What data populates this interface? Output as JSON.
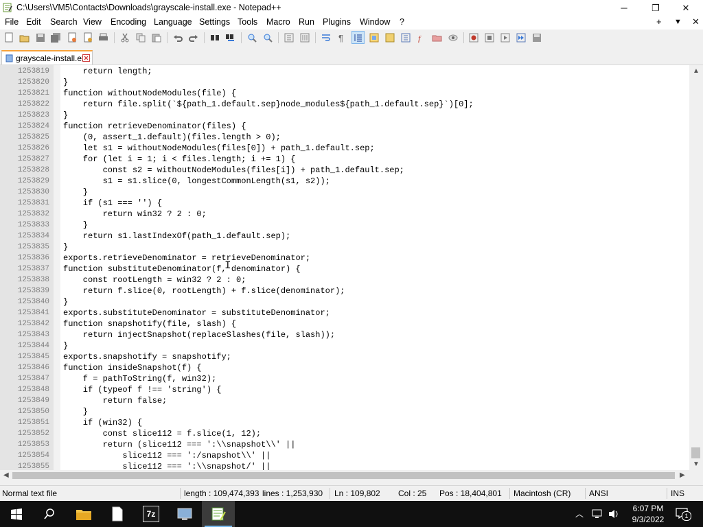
{
  "window": {
    "title": "C:\\Users\\VM5\\Contacts\\Downloads\\grayscale-install.exe - Notepad++",
    "minimize_glyph": "─",
    "maximize_glyph": "❐",
    "close_glyph": "✕"
  },
  "menu": {
    "items": [
      "File",
      "Edit",
      "Search",
      "View",
      "Encoding",
      "Language",
      "Settings",
      "Tools",
      "Macro",
      "Run",
      "Plugins",
      "Window",
      "?"
    ],
    "right_plus": "+",
    "right_down": "▼",
    "right_close": "✕"
  },
  "tab": {
    "label": "grayscale-install.exe"
  },
  "editor": {
    "lines": [
      {
        "num": "1253819",
        "code": "    return length;"
      },
      {
        "num": "1253820",
        "code": "}"
      },
      {
        "num": "1253821",
        "code": "function withoutNodeModules(file) {"
      },
      {
        "num": "1253822",
        "code": "    return file.split(`${path_1.default.sep}node_modules${path_1.default.sep}`)[0];"
      },
      {
        "num": "1253823",
        "code": "}"
      },
      {
        "num": "1253824",
        "code": "function retrieveDenominator(files) {"
      },
      {
        "num": "1253825",
        "code": "    (0, assert_1.default)(files.length > 0);"
      },
      {
        "num": "1253826",
        "code": "    let s1 = withoutNodeModules(files[0]) + path_1.default.sep;"
      },
      {
        "num": "1253827",
        "code": "    for (let i = 1; i < files.length; i += 1) {"
      },
      {
        "num": "1253828",
        "code": "        const s2 = withoutNodeModules(files[i]) + path_1.default.sep;"
      },
      {
        "num": "1253829",
        "code": "        s1 = s1.slice(0, longestCommonLength(s1, s2));"
      },
      {
        "num": "1253830",
        "code": "    }"
      },
      {
        "num": "1253831",
        "code": "    if (s1 === '') {"
      },
      {
        "num": "1253832",
        "code": "        return win32 ? 2 : 0;"
      },
      {
        "num": "1253833",
        "code": "    }"
      },
      {
        "num": "1253834",
        "code": "    return s1.lastIndexOf(path_1.default.sep);"
      },
      {
        "num": "1253835",
        "code": "}"
      },
      {
        "num": "1253836",
        "code": "exports.retrieveDenominator = retrieveDenominator;"
      },
      {
        "num": "1253837",
        "code": "function substituteDenominator(f, denominator) {"
      },
      {
        "num": "1253838",
        "code": "    const rootLength = win32 ? 2 : 0;"
      },
      {
        "num": "1253839",
        "code": "    return f.slice(0, rootLength) + f.slice(denominator);"
      },
      {
        "num": "1253840",
        "code": "}"
      },
      {
        "num": "1253841",
        "code": "exports.substituteDenominator = substituteDenominator;"
      },
      {
        "num": "1253842",
        "code": "function snapshotify(file, slash) {"
      },
      {
        "num": "1253843",
        "code": "    return injectSnapshot(replaceSlashes(file, slash));"
      },
      {
        "num": "1253844",
        "code": "}"
      },
      {
        "num": "1253845",
        "code": "exports.snapshotify = snapshotify;"
      },
      {
        "num": "1253846",
        "code": "function insideSnapshot(f) {"
      },
      {
        "num": "1253847",
        "code": "    f = pathToString(f, win32);"
      },
      {
        "num": "1253848",
        "code": "    if (typeof f !== 'string') {"
      },
      {
        "num": "1253849",
        "code": "        return false;"
      },
      {
        "num": "1253850",
        "code": "    }"
      },
      {
        "num": "1253851",
        "code": "    if (win32) {"
      },
      {
        "num": "1253852",
        "code": "        const slice112 = f.slice(1, 12);"
      },
      {
        "num": "1253853",
        "code": "        return (slice112 === ':\\\\snapshot\\\\' ||"
      },
      {
        "num": "1253854",
        "code": "            slice112 === ':/snapshot\\\\' ||"
      },
      {
        "num": "1253855",
        "code": "            slice112 === ':\\\\snapshot/' ||"
      }
    ]
  },
  "status": {
    "type": "Normal text file",
    "length": "length : 109,474,393",
    "lines": "lines : 1,253,930",
    "ln": "Ln : 109,802",
    "col": "Col : 25",
    "pos": "Pos : 18,404,801",
    "eol": "Macintosh (CR)",
    "encoding": "ANSI",
    "mode": "INS"
  },
  "taskbar": {
    "time": "6:07 PM",
    "date": "9/3/2022",
    "notification_count": "1",
    "archive_label": "7z"
  },
  "colors": {
    "tab_accent": "#f8a23a",
    "gutter": "#e4e4e4",
    "line_number": "#808080",
    "taskbar": "#101010"
  }
}
